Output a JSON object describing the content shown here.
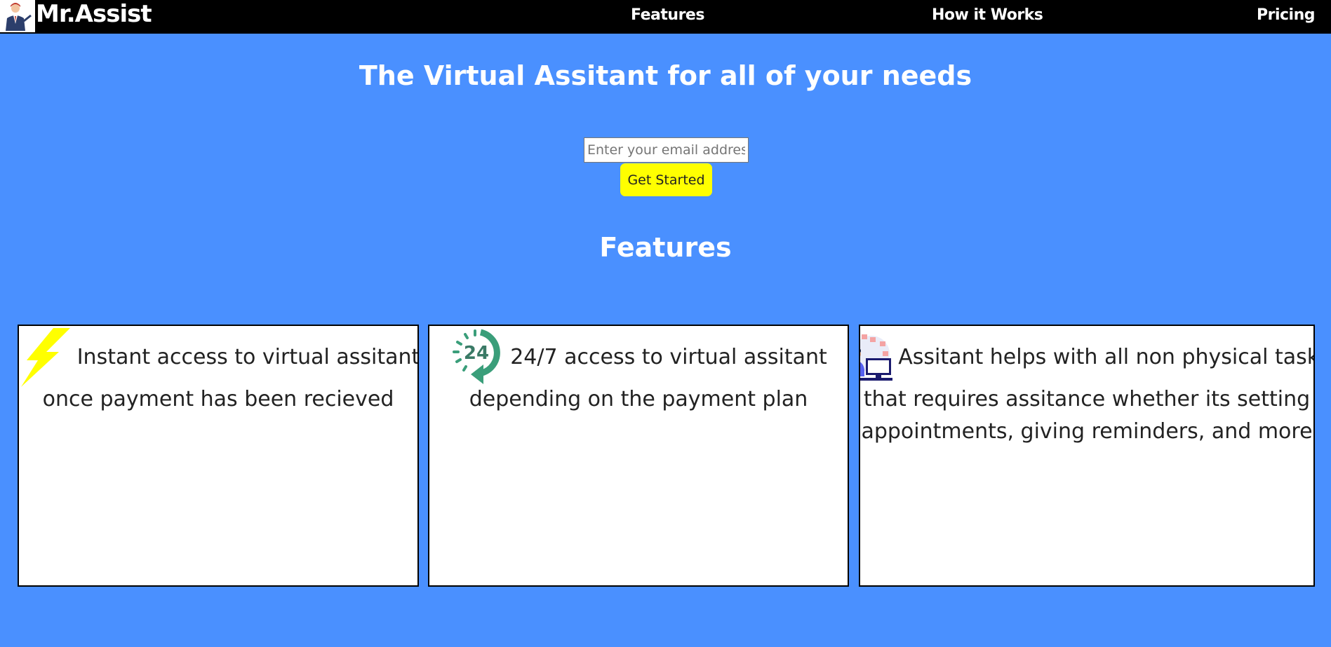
{
  "nav": {
    "brand": "Mr.Assist",
    "links": [
      "Features",
      "How it Works",
      "Pricing"
    ]
  },
  "hero": {
    "title": "The Virtual Assitant for all of your needs",
    "email_placeholder": "Enter your email address",
    "cta_label": "Get Started"
  },
  "features": {
    "title": "Features",
    "cards": [
      {
        "icon": "lightning-icon",
        "lines": [
          "Instant access to virtual assitant",
          "once payment has been recieved"
        ]
      },
      {
        "icon": "clock-24-icon",
        "icon_text": "24",
        "lines": [
          "24/7 access to virtual assitant",
          "depending on the payment plan"
        ]
      },
      {
        "icon": "assistant-computer-icon",
        "lines": [
          "Assitant helps with all non physical tasks",
          "that requires assitance whether its setting",
          "appointments, giving reminders, and more"
        ]
      }
    ]
  },
  "colors": {
    "background": "#4a90ff",
    "navbar": "#000000",
    "cta": "#ffff00",
    "lightning": "#ffff00",
    "clock": "#3a9e7a"
  }
}
